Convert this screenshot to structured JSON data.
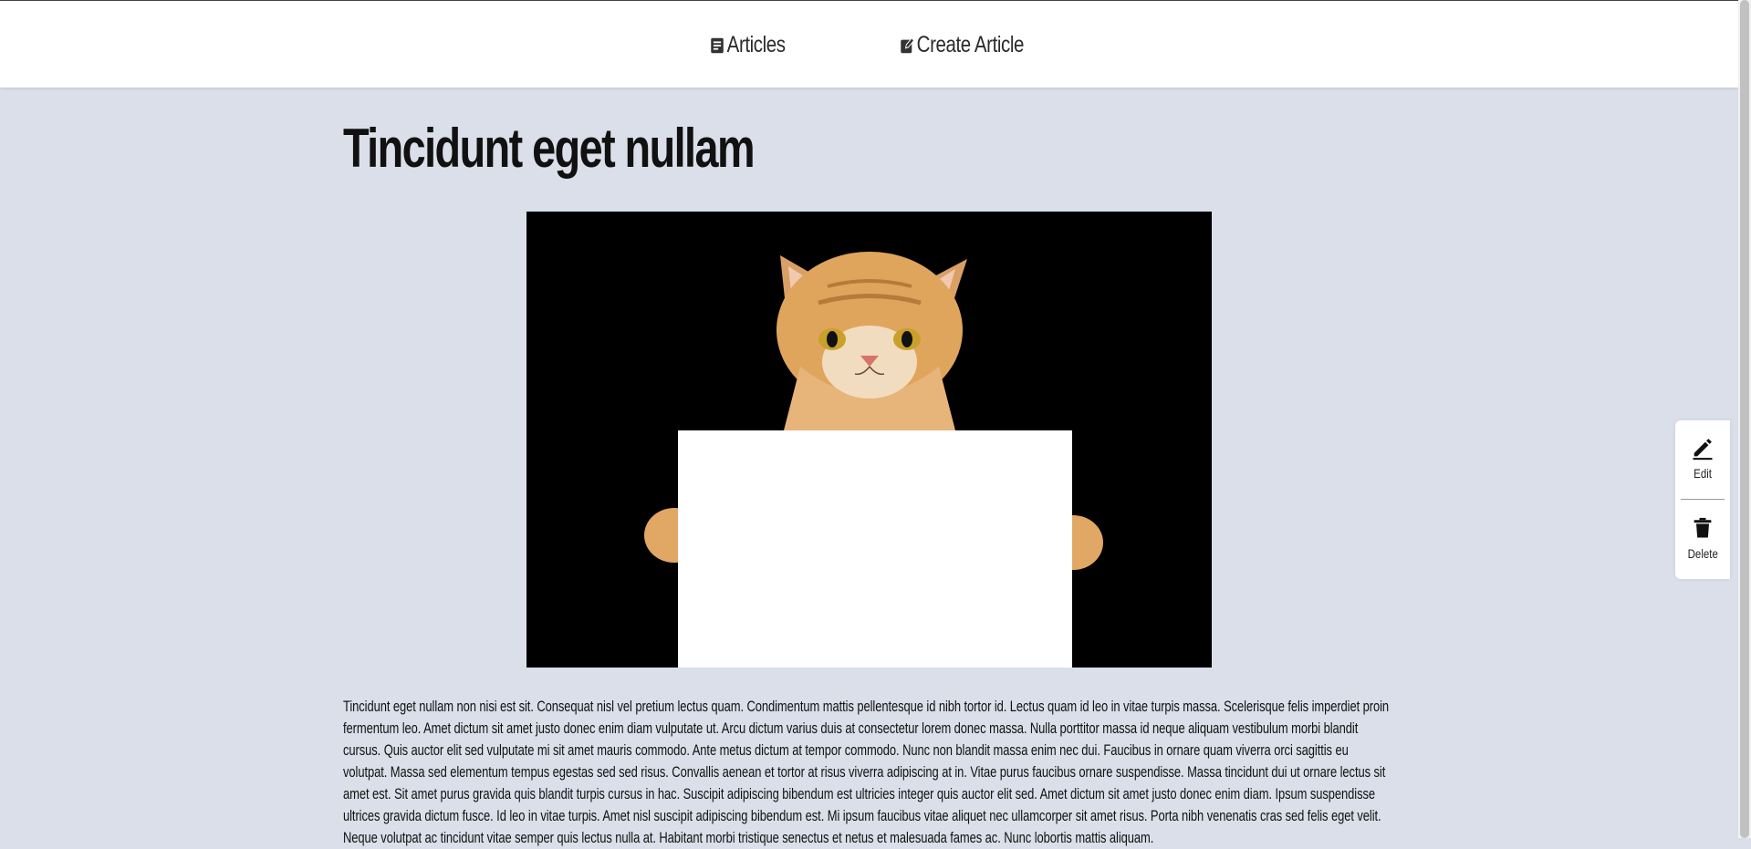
{
  "nav": {
    "articles_label": "Articles",
    "create_label": "Create Article"
  },
  "article": {
    "title": "Tincidunt eget nullam",
    "body": "Tincidunt eget nullam non nisi est sit. Consequat nisl vel pretium lectus quam. Condimentum mattis pellentesque id nibh tortor id. Lectus quam id leo in vitae turpis massa. Scelerisque felis imperdiet proin fermentum leo. Amet dictum sit amet justo donec enim diam vulputate ut. Arcu dictum varius duis at consectetur lorem donec massa. Nulla porttitor massa id neque aliquam vestibulum morbi blandit cursus. Quis auctor elit sed vulputate mi sit amet mauris commodo. Ante metus dictum at tempor commodo. Nunc non blandit massa enim nec dui. Faucibus in ornare quam viverra orci sagittis eu volutpat. Massa sed elementum tempus egestas sed sed risus. Convallis aenean et tortor at risus viverra adipiscing at in. Vitae purus faucibus ornare suspendisse. Massa tincidunt dui ut ornare lectus sit amet est. Sit amet purus gravida quis blandit turpis cursus in hac. Suscipit adipiscing bibendum est ultricies integer quis auctor elit sed. Amet dictum sit amet justo donec enim diam. Ipsum suspendisse ultrices gravida dictum fusce. Id leo in vitae turpis. Amet nisl suscipit adipiscing bibendum est. Mi ipsum faucibus vitae aliquet nec ullamcorper sit amet risus. Porta nibh venenatis cras sed felis eget velit. Neque volutpat ac tincidunt vitae semper quis lectus nulla at. Habitant morbi tristique senectus et netus et malesuada fames ac. Nunc lobortis mattis aliquam."
  },
  "side_actions": {
    "edit_label": "Edit",
    "delete_label": "Delete"
  },
  "icons": {
    "articles": "article-icon",
    "create": "edit-square-icon",
    "edit": "pencil-icon",
    "delete": "trash-icon"
  },
  "colors": {
    "background": "#dadfe9",
    "navbar": "#ffffff",
    "text": "#111111"
  }
}
